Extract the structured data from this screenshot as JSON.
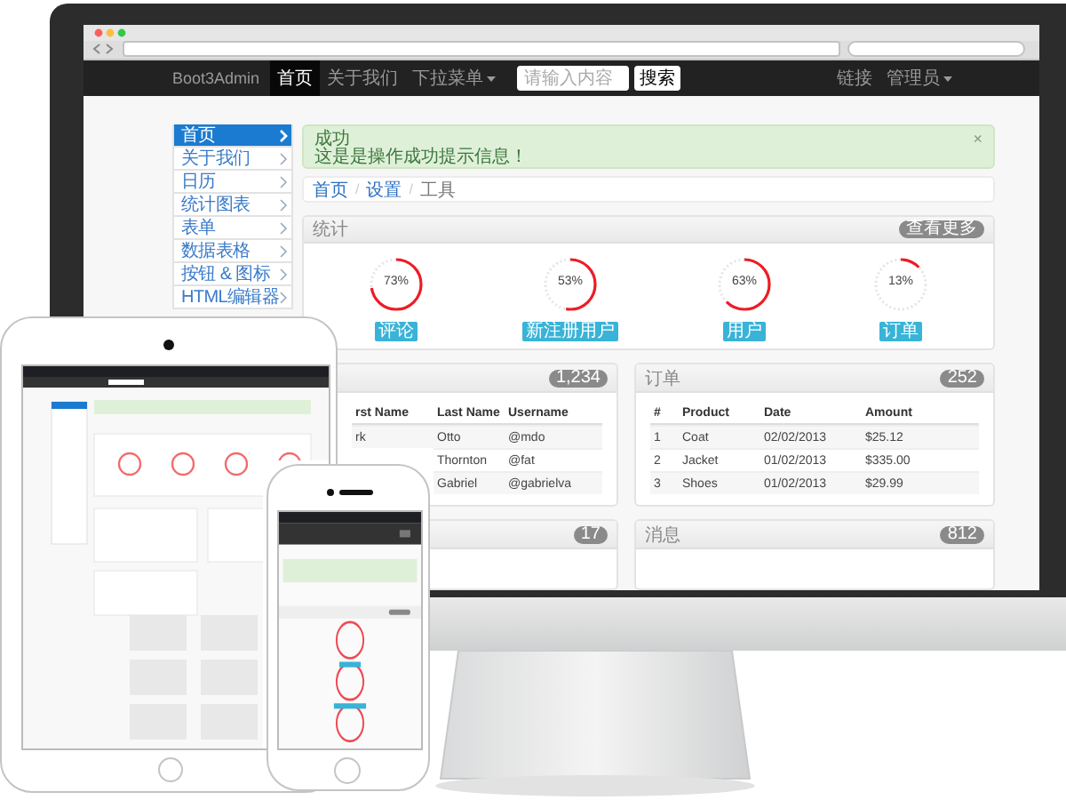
{
  "browser": {
    "nav": {
      "brand": "Boot3Admin",
      "items": [
        {
          "label": "首页",
          "selected": true,
          "kind": "link"
        },
        {
          "label": "关于我们",
          "selected": false,
          "kind": "link"
        },
        {
          "label": "下拉菜单",
          "selected": false,
          "kind": "dropdown"
        }
      ],
      "search": {
        "placeholder": "请输入内容",
        "button": "搜索"
      },
      "right_items": [
        {
          "label": "链接",
          "kind": "link"
        },
        {
          "label": "管理员",
          "kind": "dropdown"
        }
      ]
    },
    "sidebar": {
      "items": [
        {
          "label": "首页",
          "selected": true
        },
        {
          "label": "关于我们",
          "selected": false
        },
        {
          "label": "日历",
          "selected": false
        },
        {
          "label": "统计图表",
          "selected": false
        },
        {
          "label": "表单",
          "selected": false
        },
        {
          "label": "数据表格",
          "selected": false
        },
        {
          "label": "按钮 & 图标",
          "selected": false
        },
        {
          "label": "HTML编辑器",
          "selected": false
        }
      ]
    },
    "alert": {
      "title": "成功",
      "message": "这是是操作成功提示信息！",
      "close": "×"
    },
    "breadcrumb": {
      "separator": "/",
      "items": [
        "首页",
        "设置",
        "工具"
      ]
    },
    "stats": {
      "title": "统计",
      "badge": "查看更多",
      "gauges": [
        {
          "reading": "73%",
          "level": 0.73,
          "label": "评论"
        },
        {
          "reading": "53%",
          "level": 0.53,
          "label": "新注册用户"
        },
        {
          "reading": "63%",
          "level": 0.63,
          "label": "用户"
        },
        {
          "reading": "13%",
          "level": 0.13,
          "label": "订单"
        }
      ]
    },
    "users_panel": {
      "badge": "1,234",
      "columns": [
        "rst Name",
        "Last Name",
        "Username"
      ],
      "rows": [
        {
          "first_name": "rk",
          "last_name": "Otto",
          "username": "@mdo"
        },
        {
          "last_name": "Thornton",
          "username": "@fat"
        },
        {
          "last_name": "Gabriel",
          "username": "@gabrielva"
        }
      ]
    },
    "orders_panel": {
      "title": "订单",
      "badge": "252",
      "columns": [
        "#",
        "Product",
        "Date",
        "Amount"
      ],
      "rows": [
        [
          "1",
          "Coat",
          "02/02/2013",
          "$25.12"
        ],
        [
          "2",
          "Jacket",
          "01/02/2013",
          "$335.00"
        ],
        [
          "3",
          "Shoes",
          "01/02/2013",
          "$29.99"
        ]
      ]
    },
    "bottom_panels": [
      {
        "badge": "17"
      },
      {
        "title": "消息",
        "badge": "812"
      }
    ]
  },
  "devices": [
    {
      "kind": "tablet"
    },
    {
      "kind": "phone"
    }
  ]
}
